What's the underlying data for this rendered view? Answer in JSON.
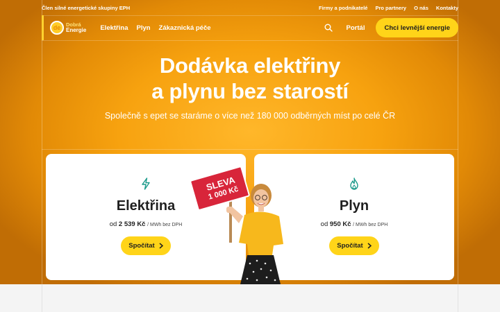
{
  "topbar": {
    "note": "Člen silné energetické skupiny EPH",
    "links": [
      "Firmy a podnikatelé",
      "Pro partnery",
      "O nás",
      "Kontakty"
    ]
  },
  "logo": {
    "line1": "Dobrá",
    "line2": "Energie",
    "mark": "de"
  },
  "nav": {
    "menu": [
      "Elektřina",
      "Plyn",
      "Zákaznická péče"
    ],
    "portal": "Portál",
    "cta": "Chci levnější energie",
    "search_icon": "search-icon"
  },
  "hero": {
    "headline_line1": "Dodávka elektřiny",
    "headline_line2": "a plynu bez starostí",
    "subtitle": "Společně s epet se staráme o více než 180 000 odběrných míst po celé ČR"
  },
  "sign": {
    "line1": "SLEVA",
    "line2": "1 000 Kč"
  },
  "cards": [
    {
      "icon": "lightning-icon",
      "title": "Elektřina",
      "price_prefix": "od",
      "price": "2 539 Kč",
      "unit": "/ MWh bez DPH",
      "button": "Spočítat"
    },
    {
      "icon": "flame-icon",
      "title": "Plyn",
      "price_prefix": "od",
      "price": "950 Kč",
      "unit": "/ MWh bez DPH",
      "button": "Spočítat"
    }
  ],
  "colors": {
    "accent": "#ffd419",
    "brand_orange": "#f7a20f",
    "icon_teal": "#1a9a8a",
    "sign_red": "#d8253a"
  }
}
